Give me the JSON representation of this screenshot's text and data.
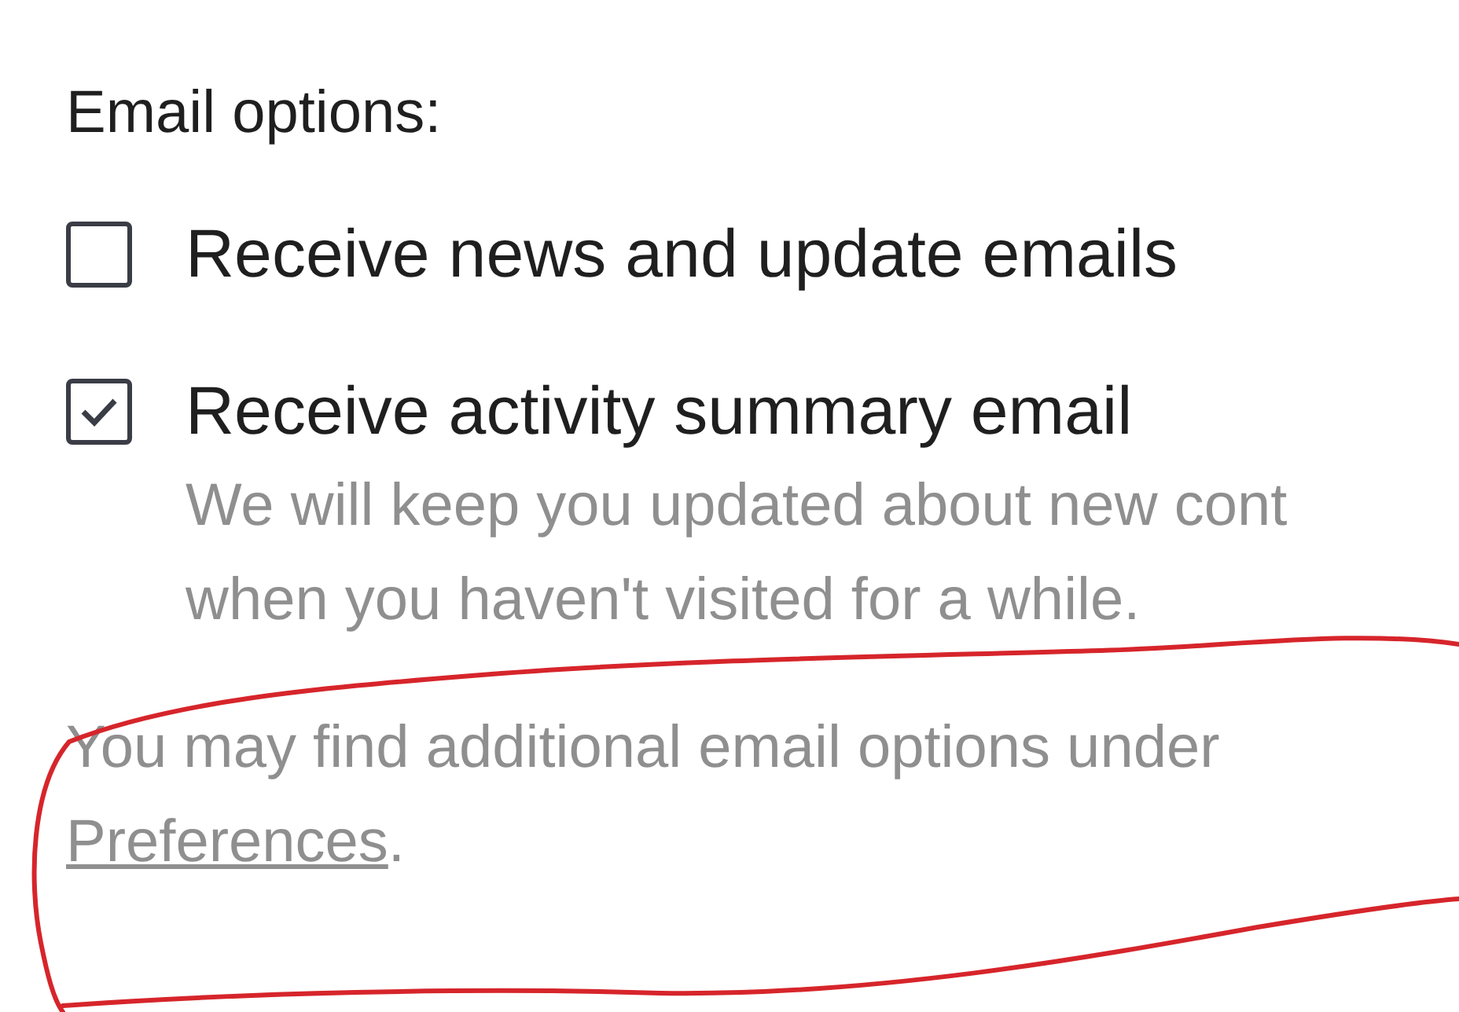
{
  "heading": "Email options:",
  "options": [
    {
      "label": "Receive news and update emails",
      "checked": false
    },
    {
      "label": "Receive activity summary email",
      "checked": true,
      "description_lines": [
        "We will keep you updated about new cont",
        "when you haven't visited for a while."
      ]
    }
  ],
  "note": {
    "text": "You may find additional email options under",
    "link": "Preferences",
    "end": "."
  }
}
